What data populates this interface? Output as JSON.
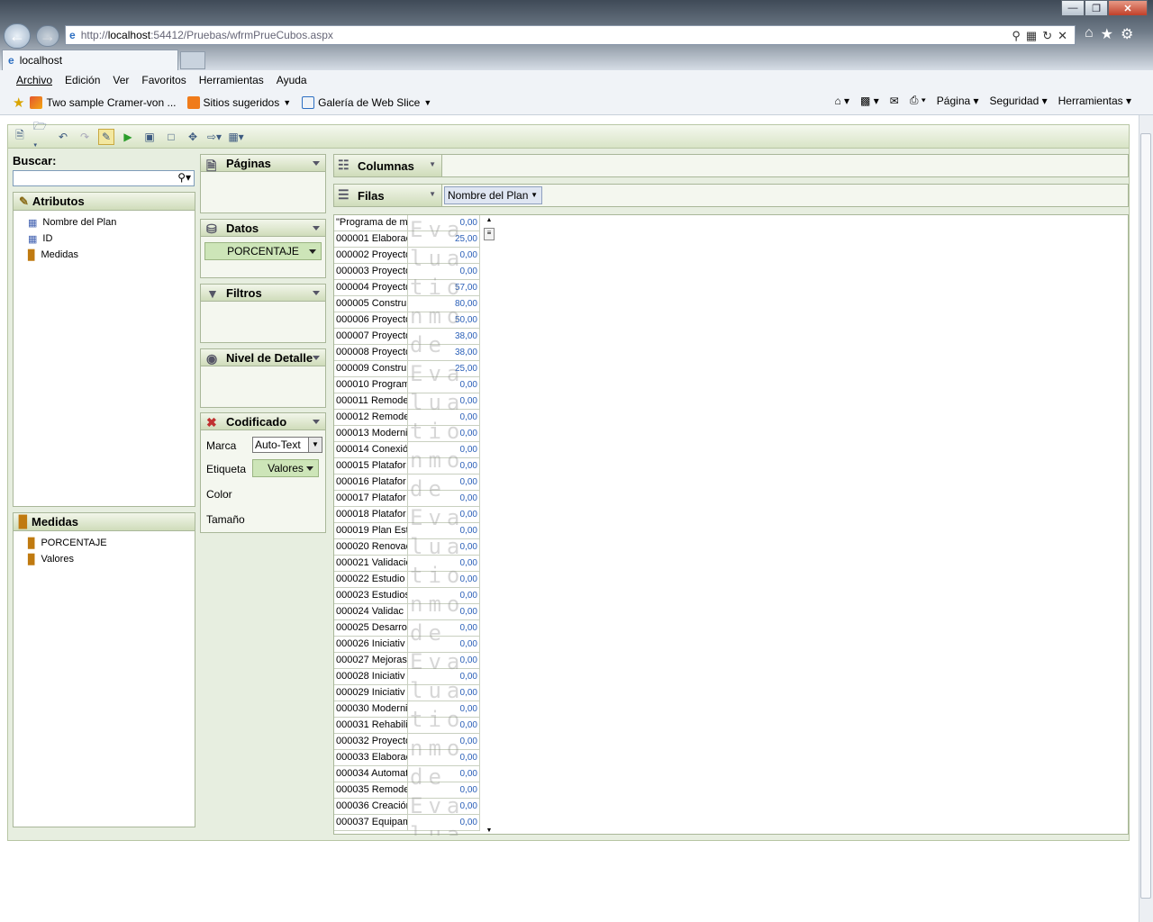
{
  "window": {
    "minimize": "—",
    "maximize": "❐",
    "close": "✕"
  },
  "address": {
    "prefix": "http://",
    "host": "localhost",
    "rest": ":54412/Pruebas/wfrmPrueCubos.aspx"
  },
  "tab": {
    "title": "localhost"
  },
  "menu": [
    "Archivo",
    "Edición",
    "Ver",
    "Favoritos",
    "Herramientas",
    "Ayuda"
  ],
  "favorites": {
    "item1": "Two sample Cramer-von ...",
    "item2": "Sitios sugeridos",
    "item3": "Galería de Web Slice"
  },
  "commands": {
    "page": "Página",
    "security": "Seguridad",
    "tools": "Herramientas"
  },
  "search": {
    "label": "Buscar:",
    "value": ""
  },
  "attributes": {
    "title": "Atributos",
    "items": [
      "Nombre del Plan",
      "ID",
      "Medidas"
    ]
  },
  "measures": {
    "title": "Medidas",
    "items": [
      "PORCENTAJE",
      "Valores"
    ]
  },
  "zones": {
    "pages": "Páginas",
    "data": "Datos",
    "data_pill": "PORCENTAJE",
    "filters": "Filtros",
    "detail": "Nivel de Detalle",
    "encoded": "Codificado",
    "mark_label": "Marca",
    "mark_value": "Auto-Text",
    "tag_label": "Etiqueta",
    "tag_value": "Valores",
    "color_label": "Color",
    "size_label": "Tamaño"
  },
  "shelves": {
    "columns": "Columnas",
    "rows": "Filas",
    "rows_pill": "Nombre del Plan"
  },
  "watermark": "Evaluation mode",
  "table": {
    "rows": [
      {
        "name": "\"Programa de m",
        "value": "0,00"
      },
      {
        "name": "000001 Elaborac",
        "value": "25,00"
      },
      {
        "name": "000002 Proyecto",
        "value": "0,00"
      },
      {
        "name": "000003 Proyecto",
        "value": "0,00"
      },
      {
        "name": "000004 Proyecto",
        "value": "57,00"
      },
      {
        "name": "000005 Constru",
        "value": "80,00"
      },
      {
        "name": "000006 Proyecto",
        "value": "50,00"
      },
      {
        "name": "000007 Proyecto",
        "value": "38,00"
      },
      {
        "name": "000008 Proyecto",
        "value": "38,00"
      },
      {
        "name": "000009 Constru",
        "value": "25,00"
      },
      {
        "name": "000010 Program",
        "value": "0,00"
      },
      {
        "name": "000011 Remode",
        "value": "0,00"
      },
      {
        "name": "000012 Remode",
        "value": "0,00"
      },
      {
        "name": "000013 Moderni",
        "value": "0,00"
      },
      {
        "name": "000014 Conexió",
        "value": "0,00"
      },
      {
        "name": "000015 Platafor",
        "value": "0,00"
      },
      {
        "name": "000016 Platafor",
        "value": "0,00"
      },
      {
        "name": "000017 Platafor",
        "value": "0,00"
      },
      {
        "name": "000018 Platafor",
        "value": "0,00"
      },
      {
        "name": "000019 Plan Est",
        "value": "0,00"
      },
      {
        "name": "000020 Renovac",
        "value": "0,00"
      },
      {
        "name": "000021 Validacio",
        "value": "0,00"
      },
      {
        "name": "000022 Estudio",
        "value": "0,00"
      },
      {
        "name": "000023 Estudios",
        "value": "0,00"
      },
      {
        "name": "000024  Validac",
        "value": "0,00"
      },
      {
        "name": "000025 Desarro",
        "value": "0,00"
      },
      {
        "name": "000026 Iniciativ",
        "value": "0,00"
      },
      {
        "name": "000027 Mejoras",
        "value": "0,00"
      },
      {
        "name": "000028 Iniciativ",
        "value": "0,00"
      },
      {
        "name": "000029 Iniciativ",
        "value": "0,00"
      },
      {
        "name": "000030 Moderni",
        "value": "0,00"
      },
      {
        "name": "000031 Rehabili",
        "value": "0,00"
      },
      {
        "name": "000032 Proyecto",
        "value": "0,00"
      },
      {
        "name": "000033 Elaborac",
        "value": "0,00"
      },
      {
        "name": "000034 Automat",
        "value": "0,00"
      },
      {
        "name": "000035 Remode",
        "value": "0,00"
      },
      {
        "name": "000036 Creación",
        "value": "0,00"
      },
      {
        "name": "000037 Equipam",
        "value": "0,00"
      }
    ]
  }
}
